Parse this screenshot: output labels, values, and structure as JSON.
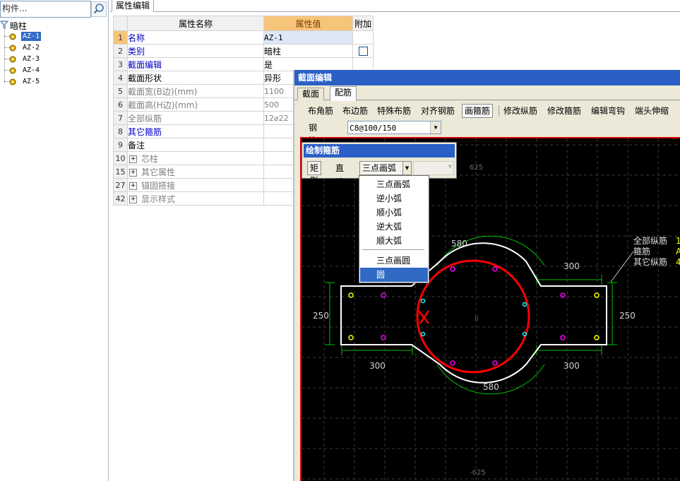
{
  "left_panel": {
    "search": {
      "placeholder": "构件..."
    },
    "tree": {
      "root_label": "暗柱",
      "items": [
        {
          "label": "AZ-1",
          "selected": true
        },
        {
          "label": "AZ-2",
          "selected": false
        },
        {
          "label": "AZ-3",
          "selected": false
        },
        {
          "label": "AZ-4",
          "selected": false
        },
        {
          "label": "AZ-5",
          "selected": false
        }
      ]
    }
  },
  "property_panel": {
    "tab_label": "属性编辑",
    "columns": {
      "name": "属性名称",
      "value": "属性值",
      "extra": "附加"
    },
    "rows": [
      {
        "num": "1",
        "name": "名称",
        "value": "AZ-1",
        "color": "blue"
      },
      {
        "num": "2",
        "name": "类别",
        "value": "暗柱",
        "color": "blue",
        "checkbox": true
      },
      {
        "num": "3",
        "name": "截面编辑",
        "value": "是",
        "color": "blue"
      },
      {
        "num": "4",
        "name": "截面形状",
        "value": "异形",
        "color": "black"
      },
      {
        "num": "5",
        "name": "截面宽(B边)(mm)",
        "value": "1100",
        "color": "gray"
      },
      {
        "num": "6",
        "name": "截面高(H边)(mm)",
        "value": "500",
        "color": "gray"
      },
      {
        "num": "7",
        "name": "全部纵筋",
        "value": "12⌀22",
        "color": "gray"
      },
      {
        "num": "8",
        "name": "其它箍筋",
        "value": "",
        "color": "blue"
      },
      {
        "num": "9",
        "name": "备注",
        "value": "",
        "color": "black"
      },
      {
        "num": "10",
        "name": "芯柱",
        "value": "",
        "group": true
      },
      {
        "num": "15",
        "name": "其它属性",
        "value": "",
        "group": true
      },
      {
        "num": "27",
        "name": "锚固搭接",
        "value": "",
        "group": true
      },
      {
        "num": "42",
        "name": "显示样式",
        "value": "",
        "group": true
      }
    ]
  },
  "section_editor": {
    "title": "截面编辑",
    "tabs": [
      {
        "label": "截面",
        "active": false
      },
      {
        "label": "配筋",
        "active": true
      }
    ],
    "toolbar": [
      "布角筋",
      "布边筋",
      "特殊布筋",
      "对齐钢筋",
      "画箍筋",
      "修改纵筋",
      "修改箍筋",
      "编辑弯钩",
      "端头伸缩"
    ],
    "toolbar_active": "画箍筋",
    "rebar_info_label": "钢筋信息",
    "rebar_info_value": "C8@100/150",
    "drawing": {
      "dim_top_left": "625",
      "dim_bottom_left": "-625",
      "dim_arc_top": "580",
      "dim_arc_bottom": "580",
      "dim_right_top": "300",
      "dim_left_bottom": "300",
      "dim_right_bottom": "300",
      "dim_left_height": "250",
      "dim_right_height": "250",
      "center_mark": "0",
      "legend_all": "全部纵筋",
      "legend_all_value": "1",
      "legend_stirrup": "箍筋",
      "legend_stirrup_value": "A",
      "legend_other": "其它纵筋",
      "legend_other_value": "4",
      "colors": {
        "background": "#000000",
        "outline": "#ffffff",
        "stirrup": "#ff0000",
        "dimension": "#00c000",
        "rebar_corner": "#ffff00",
        "rebar_edge": "#ff00ff",
        "rebar_cyan": "#00ffff"
      }
    }
  },
  "draw_stirrup_panel": {
    "title": "绘制箍筋",
    "buttons": [
      "矩形",
      "直线"
    ],
    "arc_mode": "三点画弧",
    "menu": {
      "items": [
        "三点画弧",
        "逆小弧",
        "顺小弧",
        "逆大弧",
        "顺大弧",
        "三点画圆",
        "圆"
      ],
      "highlighted": "圆"
    }
  },
  "icons": {
    "search": "search-icon",
    "tree_root": "folder-filter-icon",
    "tree_item": "gear-icon",
    "expand": "plus-icon",
    "dropdown": "chevron-down-icon"
  }
}
